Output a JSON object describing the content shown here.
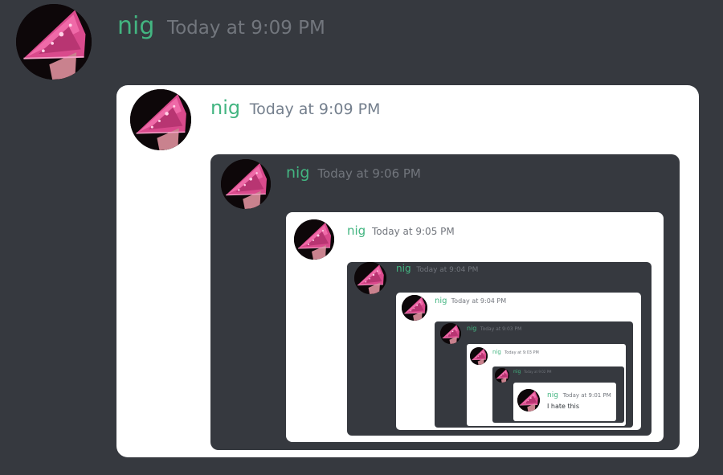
{
  "user": {
    "name": "nig",
    "name_color": "#43b581"
  },
  "messages": [
    {
      "author": "nig",
      "timestamp": "Today at 9:09 PM"
    },
    {
      "author": "nig",
      "timestamp": "Today at 9:09 PM"
    },
    {
      "author": "nig",
      "timestamp": "Today at 9:06 PM"
    },
    {
      "author": "nig",
      "timestamp": "Today at 9:05 PM"
    },
    {
      "author": "nig",
      "timestamp": "Today at 9:04 PM"
    },
    {
      "author": "nig",
      "timestamp": "Today at 9:04 PM"
    },
    {
      "author": "nig",
      "timestamp": "Today at 9:03 PM"
    },
    {
      "author": "nig",
      "timestamp": "Today at 9:03 PM"
    },
    {
      "author": "nig",
      "timestamp": "Today at 9:02 PM"
    },
    {
      "author": "nig",
      "timestamp": "Today at 9:01 PM",
      "content": "I hate this"
    }
  ],
  "colors": {
    "dark_bg": "#36393f",
    "light_bg": "#ffffff",
    "username": "#43b581"
  }
}
